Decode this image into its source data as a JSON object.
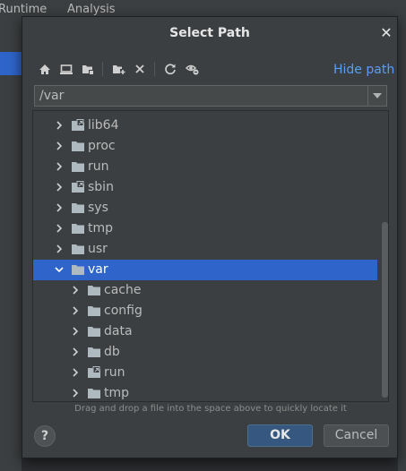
{
  "background": {
    "menu": [
      {
        "label": "Runtime"
      },
      {
        "label": "Analysis"
      }
    ]
  },
  "dialog": {
    "title": "Select Path",
    "close_label": "✕",
    "toolbar": {
      "icons": [
        "home-icon",
        "desktop-icon",
        "project-folder-icon",
        "new-folder-icon",
        "delete-icon",
        "refresh-icon",
        "show-hidden-icon"
      ]
    },
    "hide_path_label": "Hide path",
    "path_value": "/var",
    "tree": {
      "rows": [
        {
          "label": "lib64",
          "depth": 0,
          "expanded": false,
          "selected": false,
          "symlink": true
        },
        {
          "label": "proc",
          "depth": 0,
          "expanded": false,
          "selected": false,
          "symlink": false
        },
        {
          "label": "run",
          "depth": 0,
          "expanded": false,
          "selected": false,
          "symlink": false
        },
        {
          "label": "sbin",
          "depth": 0,
          "expanded": false,
          "selected": false,
          "symlink": true
        },
        {
          "label": "sys",
          "depth": 0,
          "expanded": false,
          "selected": false,
          "symlink": false
        },
        {
          "label": "tmp",
          "depth": 0,
          "expanded": false,
          "selected": false,
          "symlink": false
        },
        {
          "label": "usr",
          "depth": 0,
          "expanded": false,
          "selected": false,
          "symlink": false
        },
        {
          "label": "var",
          "depth": 0,
          "expanded": true,
          "selected": true,
          "symlink": false
        },
        {
          "label": "cache",
          "depth": 1,
          "expanded": false,
          "selected": false,
          "symlink": false
        },
        {
          "label": "config",
          "depth": 1,
          "expanded": false,
          "selected": false,
          "symlink": false
        },
        {
          "label": "data",
          "depth": 1,
          "expanded": false,
          "selected": false,
          "symlink": false
        },
        {
          "label": "db",
          "depth": 1,
          "expanded": false,
          "selected": false,
          "symlink": false
        },
        {
          "label": "run",
          "depth": 1,
          "expanded": false,
          "selected": false,
          "symlink": true
        },
        {
          "label": "tmp",
          "depth": 1,
          "expanded": false,
          "selected": false,
          "symlink": false
        }
      ]
    },
    "hint": "Drag and drop a file into the space above to quickly locate it",
    "help_label": "?",
    "ok_label": "OK",
    "cancel_label": "Cancel"
  },
  "colors": {
    "accent": "#2f65ca",
    "link": "#589df6",
    "ok_button": "#365880"
  }
}
